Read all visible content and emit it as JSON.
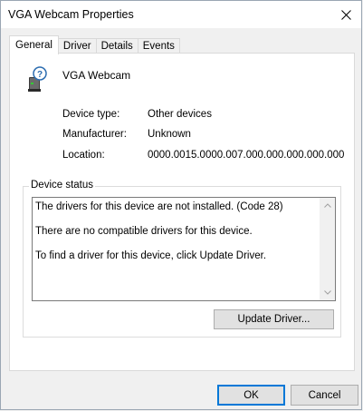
{
  "window": {
    "title": "VGA Webcam Properties"
  },
  "tabs": [
    {
      "label": "General",
      "active": true
    },
    {
      "label": "Driver",
      "active": false
    },
    {
      "label": "Details",
      "active": false
    },
    {
      "label": "Events",
      "active": false
    }
  ],
  "device": {
    "name": "VGA Webcam",
    "icon": "unknown-device-icon",
    "properties": [
      {
        "label": "Device type:",
        "value": "Other devices"
      },
      {
        "label": "Manufacturer:",
        "value": "Unknown"
      },
      {
        "label": "Location:",
        "value": "0000.0015.0000.007.000.000.000.000.000"
      }
    ]
  },
  "status": {
    "group_label": "Device status",
    "lines": [
      "The drivers for this device are not installed. (Code 28)",
      "There are no compatible drivers for this device.",
      "To find a driver for this device, click Update Driver."
    ]
  },
  "buttons": {
    "update_driver": "Update Driver...",
    "ok": "OK",
    "cancel": "Cancel"
  },
  "colors": {
    "accent": "#0078d7",
    "panel_bg": "#ffffff",
    "window_bg": "#f0f0f0"
  }
}
